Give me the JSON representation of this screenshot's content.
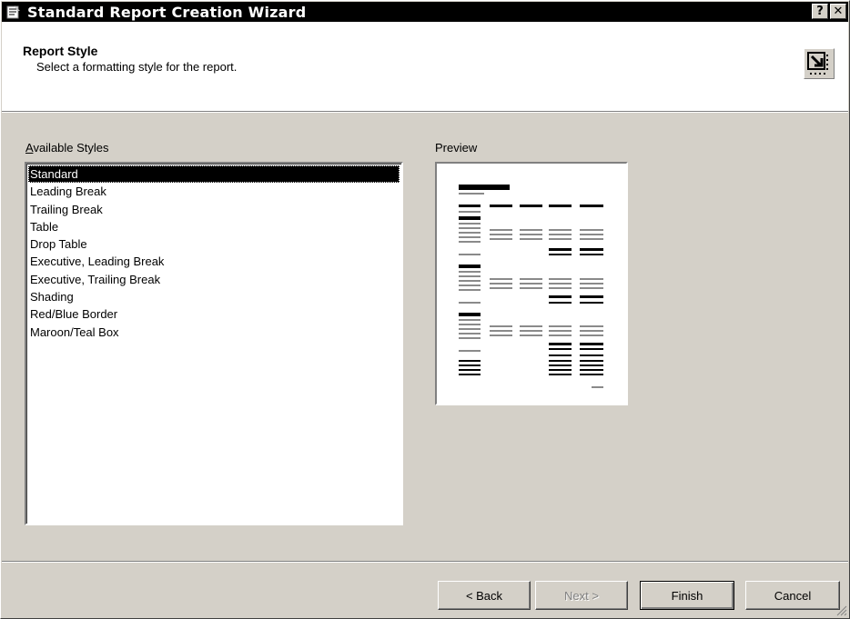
{
  "window": {
    "title": "Standard Report Creation Wizard",
    "help_button": "?",
    "close_button": "✕"
  },
  "header": {
    "title": "Report Style",
    "subtitle": "Select a formatting style for the report.",
    "icon": "wizard-arrow-icon"
  },
  "styles": {
    "label": "Available Styles",
    "accelerator": "A",
    "selected_index": 0,
    "items": [
      "Standard",
      "Leading Break",
      "Trailing Break",
      "Table",
      "Drop Table",
      "Executive, Leading Break",
      "Executive, Trailing Break",
      "Shading",
      "Red/Blue Border",
      "Maroon/Teal Box"
    ]
  },
  "preview": {
    "label": "Preview"
  },
  "buttons": {
    "back": "< Back",
    "next": "Next >",
    "finish": "Finish",
    "cancel": "Cancel"
  },
  "colors": {
    "dialog_face": "#d4d0c8",
    "selection": "#000000",
    "title_bar": "#000000"
  }
}
